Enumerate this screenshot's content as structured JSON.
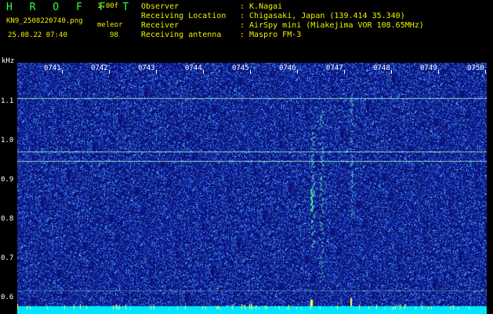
{
  "header": {
    "brand": "H R O F F T",
    "version": "1.00f",
    "filename": "KN9_2508220740.png",
    "software": "meleor",
    "date_time": "25.08.22 07:40",
    "count": "98",
    "rows": [
      {
        "label": "Observer",
        "value": ": K.Nagai"
      },
      {
        "label": "Receiving Location",
        "value": ": Chigasaki, Japan (139.414 35.340)"
      },
      {
        "label": "Receiver",
        "value": ": AirSpy mini (Miakejima VOR 108.65MHz)"
      },
      {
        "label": "Receiving antenna",
        "value": ": Maspro FM-3"
      }
    ]
  },
  "plot": {
    "y_unit": "kHz",
    "x_ticks": [
      "0741",
      "0742",
      "0743",
      "0744",
      "0745",
      "0746",
      "0747",
      "0748",
      "0749",
      "0750"
    ],
    "y_ticks": [
      "1.1",
      "1.0",
      "0.9",
      "0.8",
      "0.7",
      "0.6"
    ],
    "colors": {
      "background": "#0a0f6e",
      "noise": "#3a6cff",
      "line": "#a8ffd8",
      "bottom": "#00e5ff",
      "spike": "#ffff40"
    }
  }
}
